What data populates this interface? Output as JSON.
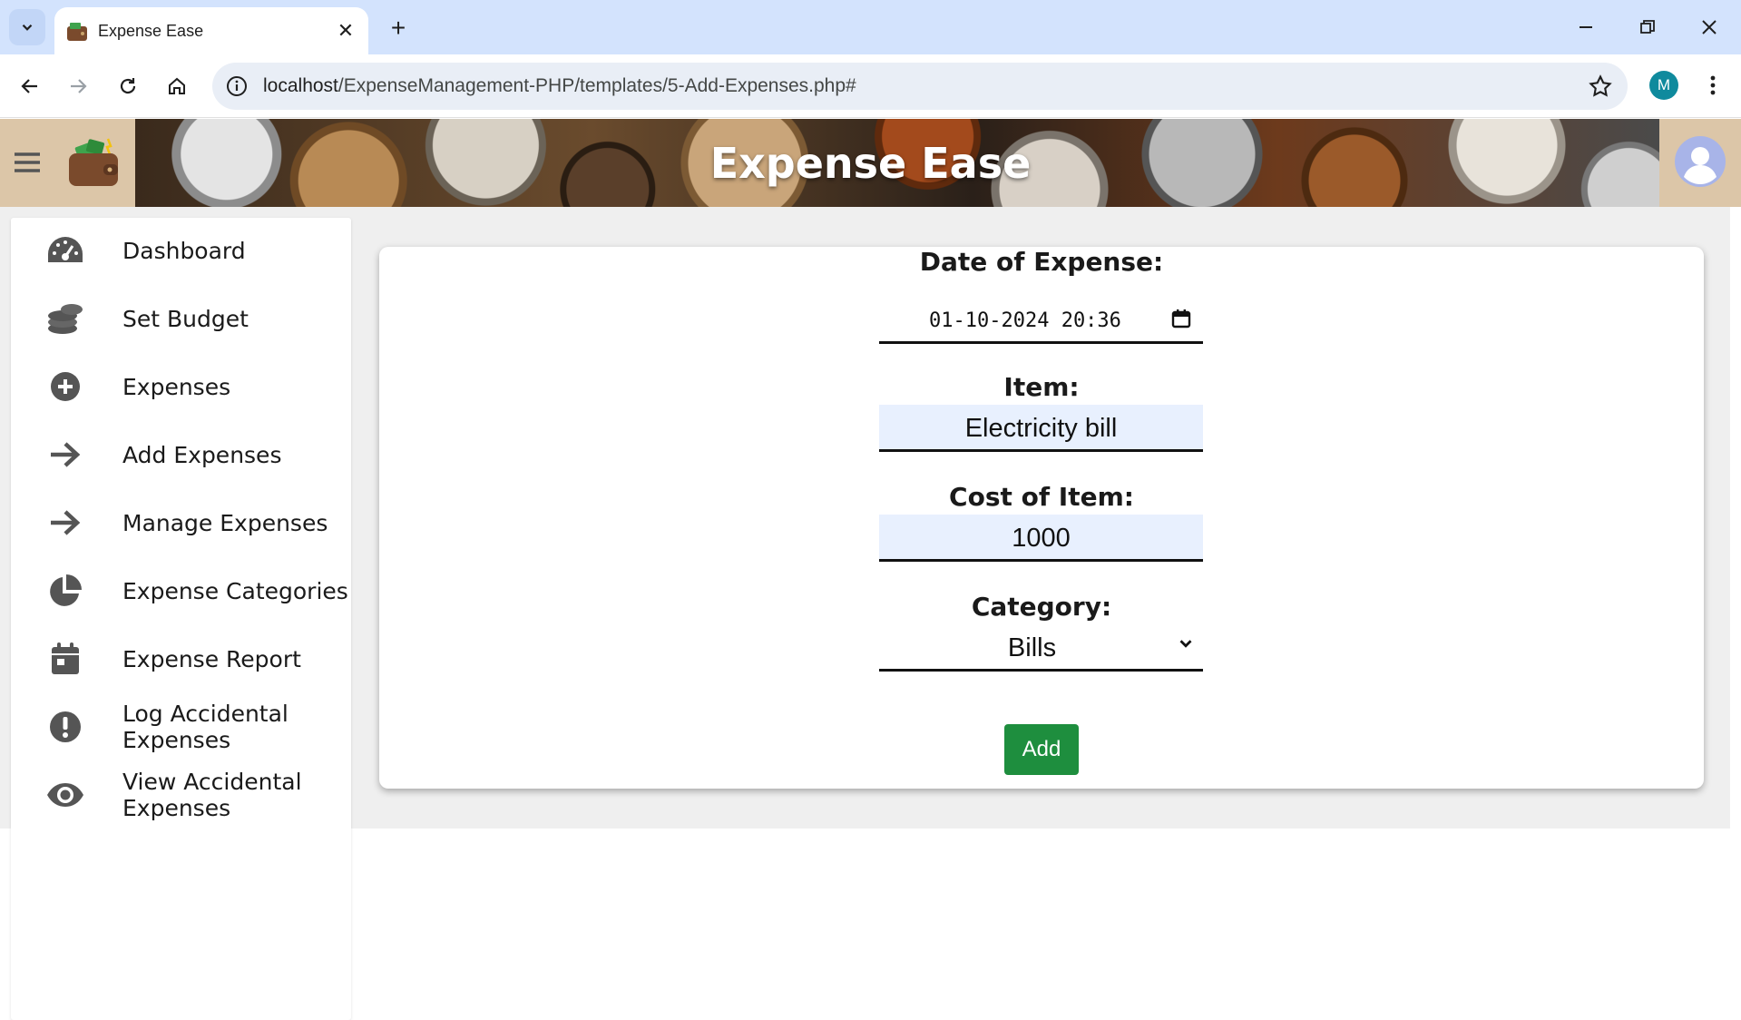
{
  "browser": {
    "tab_title": "Expense Ease",
    "url_host": "localhost",
    "url_path": "/ExpenseManagement-PHP/templates/5-Add-Expenses.php#",
    "profile_initial": "M"
  },
  "header": {
    "title": "Expense Ease"
  },
  "sidebar": {
    "items": [
      {
        "label": "Dashboard",
        "icon": "gauge-icon"
      },
      {
        "label": "Set Budget",
        "icon": "coins-icon"
      },
      {
        "label": "Expenses",
        "icon": "plus-circle-icon"
      },
      {
        "label": "Add Expenses",
        "icon": "arrow-right-icon"
      },
      {
        "label": "Manage Expenses",
        "icon": "arrow-right-icon"
      },
      {
        "label": "Expense Categories",
        "icon": "pie-chart-icon"
      },
      {
        "label": "Expense Report",
        "icon": "calendar-icon"
      },
      {
        "label": "Log Accidental Expenses",
        "icon": "exclamation-circle-icon"
      },
      {
        "label": "View Accidental Expenses",
        "icon": "eye-icon"
      }
    ]
  },
  "form": {
    "date_label": "Date of Expense:",
    "date_value": "01-10-2024 20:36",
    "item_label": "Item:",
    "item_value": "Electricity bill",
    "cost_label": "Cost of Item:",
    "cost_value": "1000",
    "category_label": "Category:",
    "category_value": "Bills",
    "submit_label": "Add"
  },
  "colors": {
    "accent_button": "#1e8e3e",
    "input_fill": "#e8f0fe",
    "header_bg": "#dcc6a8"
  }
}
